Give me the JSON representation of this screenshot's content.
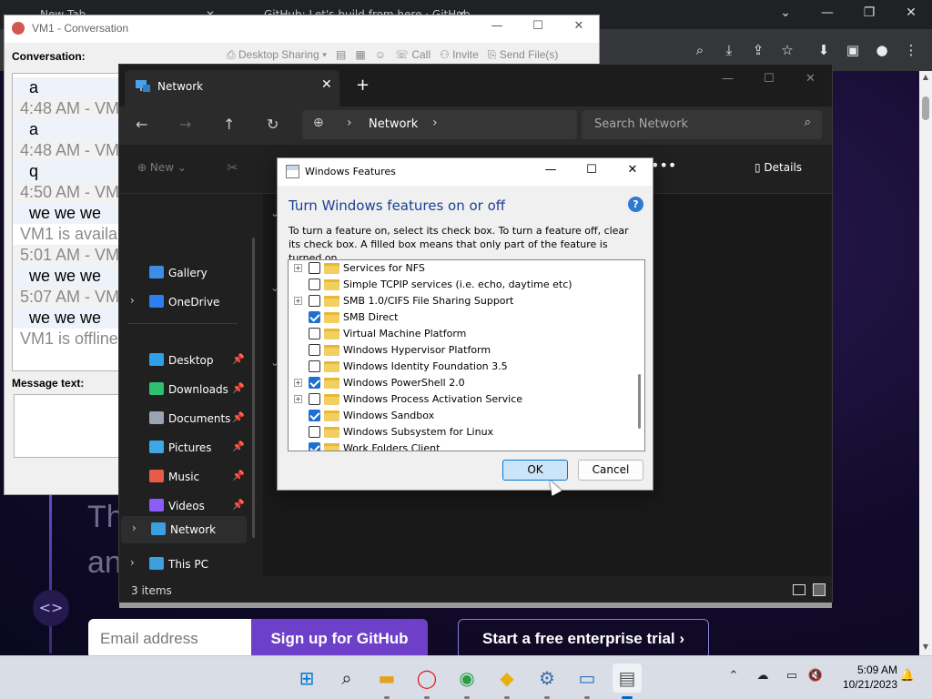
{
  "browser": {
    "tabs": [
      {
        "label": "New Tab"
      },
      {
        "label": "GitHub: Let's build from here · GitHub"
      }
    ],
    "page": {
      "hero_text": "Th\nan",
      "email_placeholder": "Email address",
      "signup_label": "Sign up for GitHub",
      "trial_label": "Start a free enterprise trial ›"
    }
  },
  "conversation": {
    "title": "VM1 - Conversation",
    "label": "Conversation:",
    "toolbar": {
      "desktop_sharing": "Desktop Sharing ▾",
      "call": "Call",
      "invite": "Invite",
      "send_files": "Send File(s)"
    },
    "log": [
      {
        "kind": "text",
        "value": "a"
      },
      {
        "kind": "time",
        "value": "4:48 AM - VM1"
      },
      {
        "kind": "text",
        "value": "a"
      },
      {
        "kind": "time",
        "value": "4:48 AM - VM1"
      },
      {
        "kind": "text",
        "value": "q"
      },
      {
        "kind": "time",
        "value": "4:50 AM - VM1"
      },
      {
        "kind": "text",
        "value": "we we we"
      },
      {
        "kind": "status",
        "value": "VM1 is available"
      },
      {
        "kind": "time",
        "value": "5:01 AM - VM1"
      },
      {
        "kind": "text",
        "value": "we we we"
      },
      {
        "kind": "time",
        "value": "5:07 AM - VM1"
      },
      {
        "kind": "text",
        "value": "we we we"
      },
      {
        "kind": "status",
        "value": "VM1 is offline"
      }
    ],
    "message_label": "Message text:"
  },
  "explorer": {
    "tab_title": "Network",
    "address": "Network",
    "search_placeholder": "Search Network",
    "new_label": "New",
    "details_label": "Details",
    "nav_items": [
      {
        "label": "Gallery",
        "color": "#3a8ee6"
      },
      {
        "label": "OneDrive",
        "color": "#2d7ff0"
      },
      {
        "label": "Desktop",
        "color": "#2f9fe8"
      },
      {
        "label": "Downloads",
        "color": "#2fbf71"
      },
      {
        "label": "Documents",
        "color": "#9aa4b2"
      },
      {
        "label": "Pictures",
        "color": "#3fa6e8"
      },
      {
        "label": "Music",
        "color": "#e85a4a"
      },
      {
        "label": "Videos",
        "color": "#8b5cf6"
      },
      {
        "label": "This PC",
        "color": "#3aa0e0"
      },
      {
        "label": "Network",
        "color": "#3aa0e0"
      }
    ],
    "status": "3 items"
  },
  "features": {
    "title": "Windows Features",
    "heading": "Turn Windows features on or off",
    "description": "To turn a feature on, select its check box. To turn a feature off, clear its check box. A filled box means that only part of the feature is turned on.",
    "items": [
      {
        "label": "Services for NFS",
        "expandable": true,
        "checked": false
      },
      {
        "label": "Simple TCPIP services (i.e. echo, daytime etc)",
        "expandable": false,
        "checked": false
      },
      {
        "label": "SMB 1.0/CIFS File Sharing Support",
        "expandable": true,
        "checked": false
      },
      {
        "label": "SMB Direct",
        "expandable": false,
        "checked": true
      },
      {
        "label": "Virtual Machine Platform",
        "expandable": false,
        "checked": false
      },
      {
        "label": "Windows Hypervisor Platform",
        "expandable": false,
        "checked": false
      },
      {
        "label": "Windows Identity Foundation 3.5",
        "expandable": false,
        "checked": false
      },
      {
        "label": "Windows PowerShell 2.0",
        "expandable": true,
        "checked": true
      },
      {
        "label": "Windows Process Activation Service",
        "expandable": true,
        "checked": false
      },
      {
        "label": "Windows Sandbox",
        "expandable": false,
        "checked": true
      },
      {
        "label": "Windows Subsystem for Linux",
        "expandable": false,
        "checked": false
      },
      {
        "label": "Work Folders Client",
        "expandable": false,
        "checked": true
      }
    ],
    "ok_label": "OK",
    "cancel_label": "Cancel"
  },
  "taskbar": {
    "time": "5:09 AM",
    "date": "10/21/2023"
  }
}
